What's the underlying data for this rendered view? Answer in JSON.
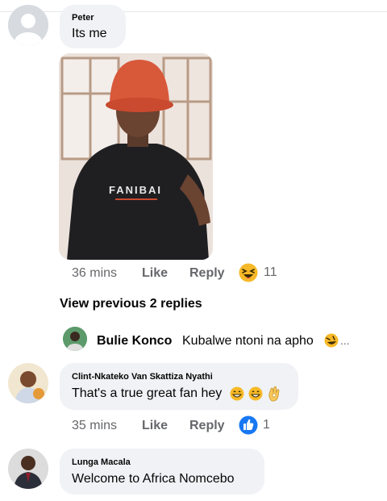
{
  "comments": [
    {
      "author": "Peter",
      "text": "Its me",
      "photo_shirt_text": "FANIBAI",
      "time": "36 mins",
      "like_label": "Like",
      "reply_label": "Reply",
      "reaction_icon": "laughing-emoji",
      "reaction_count": "11"
    },
    {
      "author": "Clint-Nkateko Van Skattiza Nyathi",
      "text": "That's a true great fan hey",
      "time": "35 mins",
      "like_label": "Like",
      "reply_label": "Reply",
      "reaction_icon": "like-thumb",
      "reaction_count": "1"
    },
    {
      "author": "Lunga Macala",
      "text": "Welcome to Africa Nomcebo"
    }
  ],
  "replies": {
    "view_previous_label": "View previous 2 replies",
    "preview_author": "Bulie Konco",
    "preview_text": "Kubalwe ntoni na apho",
    "preview_more": "..."
  },
  "colors": {
    "bubble": "#f0f2f5",
    "meta_text": "#65676b",
    "like_blue": "#1877f2",
    "emoji_yellow": "#f7b928"
  }
}
